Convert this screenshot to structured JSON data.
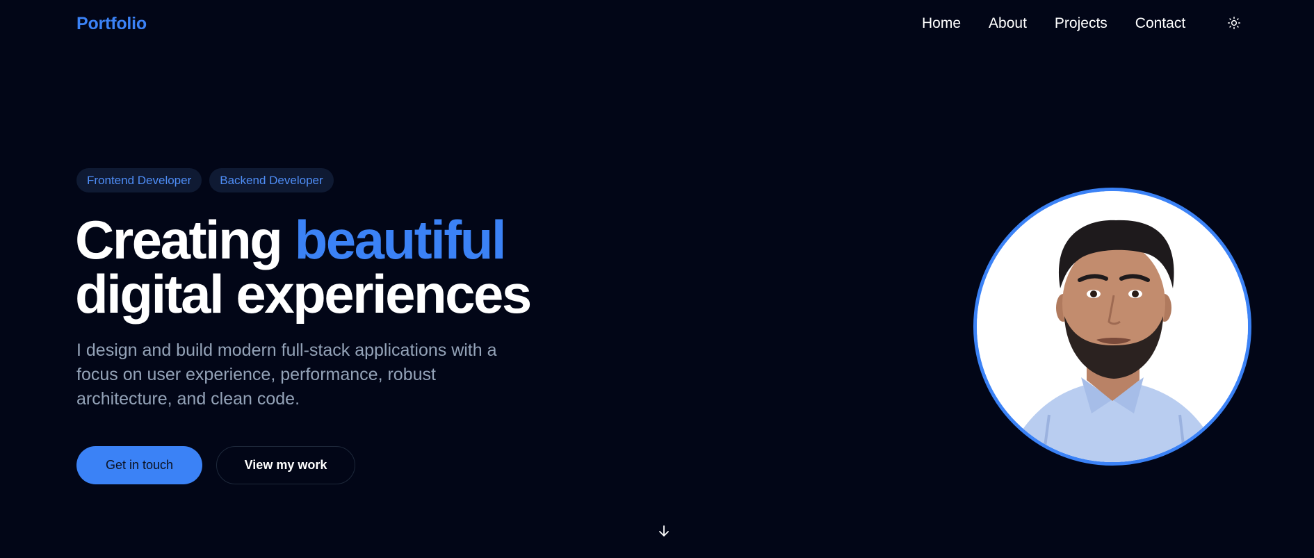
{
  "brand": {
    "logo": "Portfolio",
    "accent_color": "#3b82f6"
  },
  "nav": {
    "items": [
      {
        "label": "Home"
      },
      {
        "label": "About"
      },
      {
        "label": "Projects"
      },
      {
        "label": "Contact"
      }
    ],
    "theme_toggle_icon": "sun-icon"
  },
  "hero": {
    "badges": [
      "Frontend Developer",
      "Backend Developer"
    ],
    "headline": {
      "part1": "Creating ",
      "accent": "beautiful",
      "line2": "digital experiences"
    },
    "subtitle": "I design and build modern full-stack applications with a focus on user experience, performance, robust architecture, and clean code.",
    "primary_cta": "Get in touch",
    "secondary_cta": "View my work",
    "avatar_icon": "profile-photo",
    "scroll_icon": "arrow-down-icon"
  },
  "colors": {
    "background": "#020617",
    "text": "#ffffff",
    "muted_text": "#94a3b8",
    "badge_bg": "#0f1a33"
  }
}
